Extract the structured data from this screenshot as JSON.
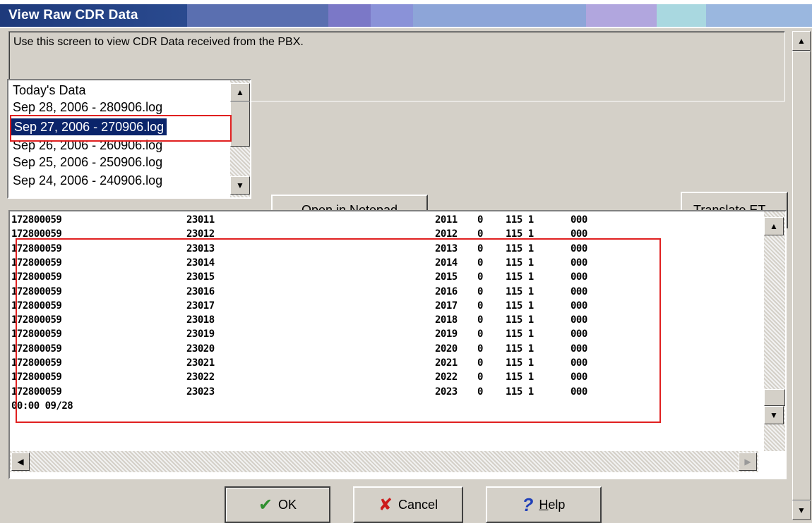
{
  "window": {
    "title": "View Raw CDR Data",
    "description": "Use this screen to view CDR Data received from the PBX."
  },
  "log_list": {
    "items": [
      "Today's Data",
      "Sep 28, 2006 - 280906.log",
      "Sep 27, 2006 - 270906.log",
      "Sep 26, 2006 - 260906.log",
      "Sep 25, 2006 - 250906.log",
      "Sep 24, 2006 - 240906.log"
    ],
    "selected": "Sep 27, 2006 - 270906.log"
  },
  "buttons": {
    "open_notepad": "Open in Notepad",
    "translate": "Translate ET",
    "ok": "OK",
    "cancel": "Cancel",
    "help_h": "H",
    "help_rest": "elp"
  },
  "cdr_rows": [
    [
      "172800059",
      "23011",
      "2011",
      "0",
      "115 1",
      "000"
    ],
    [
      "172800059",
      "23012",
      "2012",
      "0",
      "115 1",
      "000"
    ],
    [
      "172800059",
      "23013",
      "2013",
      "0",
      "115 1",
      "000"
    ],
    [
      "172800059",
      "23014",
      "2014",
      "0",
      "115 1",
      "000"
    ],
    [
      "172800059",
      "23015",
      "2015",
      "0",
      "115 1",
      "000"
    ],
    [
      "172800059",
      "23016",
      "2016",
      "0",
      "115 1",
      "000"
    ],
    [
      "172800059",
      "23017",
      "2017",
      "0",
      "115 1",
      "000"
    ],
    [
      "172800059",
      "23018",
      "2018",
      "0",
      "115 1",
      "000"
    ],
    [
      "172800059",
      "23019",
      "2019",
      "0",
      "115 1",
      "000"
    ],
    [
      "172800059",
      "23020",
      "2020",
      "0",
      "115 1",
      "000"
    ],
    [
      "172800059",
      "23021",
      "2021",
      "0",
      "115 1",
      "000"
    ],
    [
      "172800059",
      "23022",
      "2022",
      "0",
      "115 1",
      "000"
    ],
    [
      "172800059",
      "23023",
      "2023",
      "0",
      "115 1",
      "000"
    ]
  ],
  "footer_line": "00:00 09/28",
  "colors": {
    "selection": "#0a246a",
    "highlight_outline": "#e02020",
    "title_bar": "#0a246a"
  }
}
